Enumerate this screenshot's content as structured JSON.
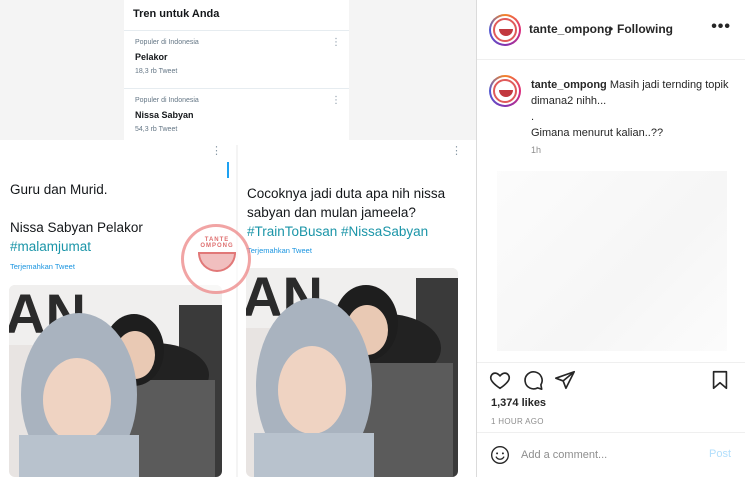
{
  "post_image": {
    "trends": {
      "heading": "Tren untuk Anda",
      "items": [
        {
          "meta": "Populer di Indonesia",
          "name": "Pelakor",
          "count": "18,3 rb Tweet"
        },
        {
          "meta": "Populer di Indonesia",
          "name": "Nissa Sabyan",
          "count": "54,3 rb Tweet"
        }
      ]
    },
    "tweet_left": {
      "line1": "Guru dan Murid.",
      "line2": "Nissa Sabyan Pelakor",
      "hashtag": "#malamjumat",
      "translate": "Terjemahkan Tweet"
    },
    "tweet_right": {
      "text": "Cocoknya jadi duta apa nih nissa sabyan dan mulan jameela?",
      "hashtags": "#TrainToBusan #NissaSabyan",
      "translate": "Terjemahkan Tweet"
    },
    "watermark": "TANTE OMPONG"
  },
  "header": {
    "username": "tante_ompong",
    "separator": "•",
    "follow_status": "Following",
    "options_icon": "more-horizontal-icon"
  },
  "caption": {
    "username": "tante_ompong",
    "line1": "Masih jadi ternding topik dimana2 nihh...",
    "line2": ".",
    "line3": "Gimana menurut kalian..??",
    "time": "1h"
  },
  "actions": {
    "icons": [
      "heart-icon",
      "comment-icon",
      "share-icon",
      "bookmark-icon"
    ],
    "likes": "1,374 likes",
    "post_time": "1 HOUR AGO"
  },
  "comment": {
    "placeholder": "Add a comment...",
    "post_label": "Post"
  },
  "colors": {
    "hashtag": "#1b95a8",
    "link": "#1b95e0",
    "post_disabled": "#b2dffc"
  }
}
